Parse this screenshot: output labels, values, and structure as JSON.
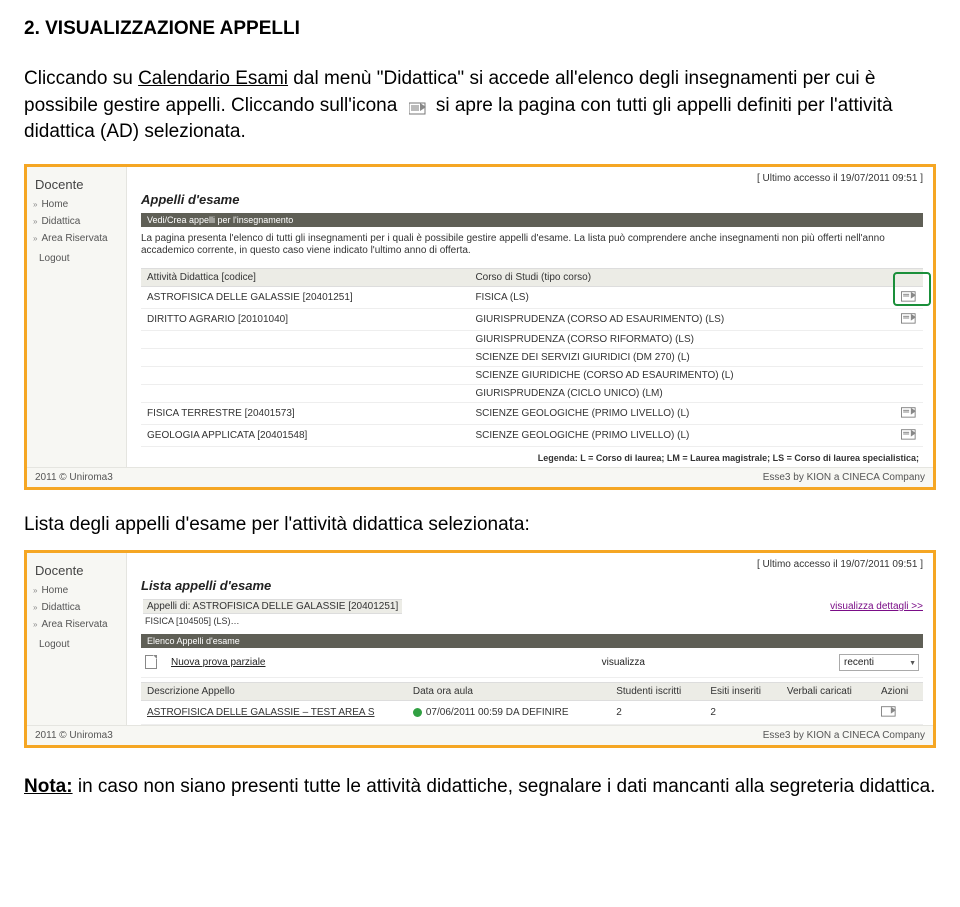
{
  "doc": {
    "section_title": "2. VISUALIZZAZIONE APPELLI",
    "intro_a": "Cliccando su ",
    "intro_link": "Calendario Esami",
    "intro_b": " dal menù \"Didattica\" si accede all'elenco degli insegnamenti per cui è possibile gestire appelli. Cliccando sull'icona ",
    "intro_c": " si apre la pagina con tutti gli appelli definiti per l'attività didattica (AD) selezionata.",
    "caption": "Lista degli appelli d'esame per l'attività didattica selezionata:",
    "note_label": "Nota:",
    "note_text": " in caso non siano presenti tutte le attività didattiche, segnalare i dati mancanti alla segreteria didattica."
  },
  "side": {
    "title": "Docente",
    "items": [
      "Home",
      "Didattica",
      "Area Riservata"
    ],
    "logout": "Logout"
  },
  "access": "[ Ultimo accesso il 19/07/2011 09:51 ]",
  "ss1": {
    "h1": "Appelli d'esame",
    "bar": "Vedi/Crea appelli per l'insegnamento",
    "desc": "La pagina presenta l'elenco di tutti gli insegnamenti per i quali è possibile gestire appelli d'esame. La lista può comprendere anche insegnamenti non più offerti nell'anno accademico corrente, in questo caso viene indicato l'ultimo anno di offerta.",
    "th_ad": "Attività Didattica [codice]",
    "th_cs": "Corso di Studi (tipo corso)",
    "rows": [
      {
        "ad": "ASTROFISICA DELLE GALASSIE [20401251]",
        "cs": "FISICA (LS)",
        "act": true
      },
      {
        "ad": "DIRITTO AGRARIO [20101040]",
        "cs": "GIURISPRUDENZA (CORSO AD ESAURIMENTO) (LS)",
        "act": true
      },
      {
        "ad": "",
        "cs": "GIURISPRUDENZA (CORSO RIFORMATO) (LS)",
        "act": false
      },
      {
        "ad": "",
        "cs": "SCIENZE DEI SERVIZI GIURIDICI (DM 270) (L)",
        "act": false
      },
      {
        "ad": "",
        "cs": "SCIENZE GIURIDICHE (CORSO AD ESAURIMENTO) (L)",
        "act": false
      },
      {
        "ad": "",
        "cs": "GIURISPRUDENZA (CICLO UNICO) (LM)",
        "act": false
      },
      {
        "ad": "FISICA TERRESTRE [20401573]",
        "cs": "SCIENZE GEOLOGICHE (PRIMO LIVELLO) (L)",
        "act": true
      },
      {
        "ad": "GEOLOGIA APPLICATA [20401548]",
        "cs": "SCIENZE GEOLOGICHE (PRIMO LIVELLO) (L)",
        "act": true
      }
    ],
    "legend": "Legenda: L = Corso di laurea;  LM = Laurea magistrale;  LS = Corso di laurea specialistica;"
  },
  "footer": {
    "left": "2011 © Uniroma3",
    "right": "Esse3 by KION a CINECA Company"
  },
  "ss2": {
    "h1": "Lista appelli d'esame",
    "sub_ad": "Appelli di: ASTROFISICA DELLE GALASSIE [20401251]",
    "sub_cs": "FISICA [104505] (LS)…",
    "detail_link": "visualizza dettagli >>",
    "bar": "Elenco Appelli d'esame",
    "filter_new": "Nuova prova parziale",
    "filter_vis": "visualizza",
    "filter_sel": "recenti",
    "th_desc": "Descrizione Appello",
    "th_date": "Data ora aula",
    "th_stud": "Studenti iscritti",
    "th_esiti": "Esiti inseriti",
    "th_verb": "Verbali caricati",
    "th_act": "Azioni",
    "row_desc": "ASTROFISICA DELLE GALASSIE – TEST AREA S",
    "row_date": "07/06/2011 00:59 DA DEFINIRE",
    "row_stud": "2",
    "row_esiti": "2"
  }
}
